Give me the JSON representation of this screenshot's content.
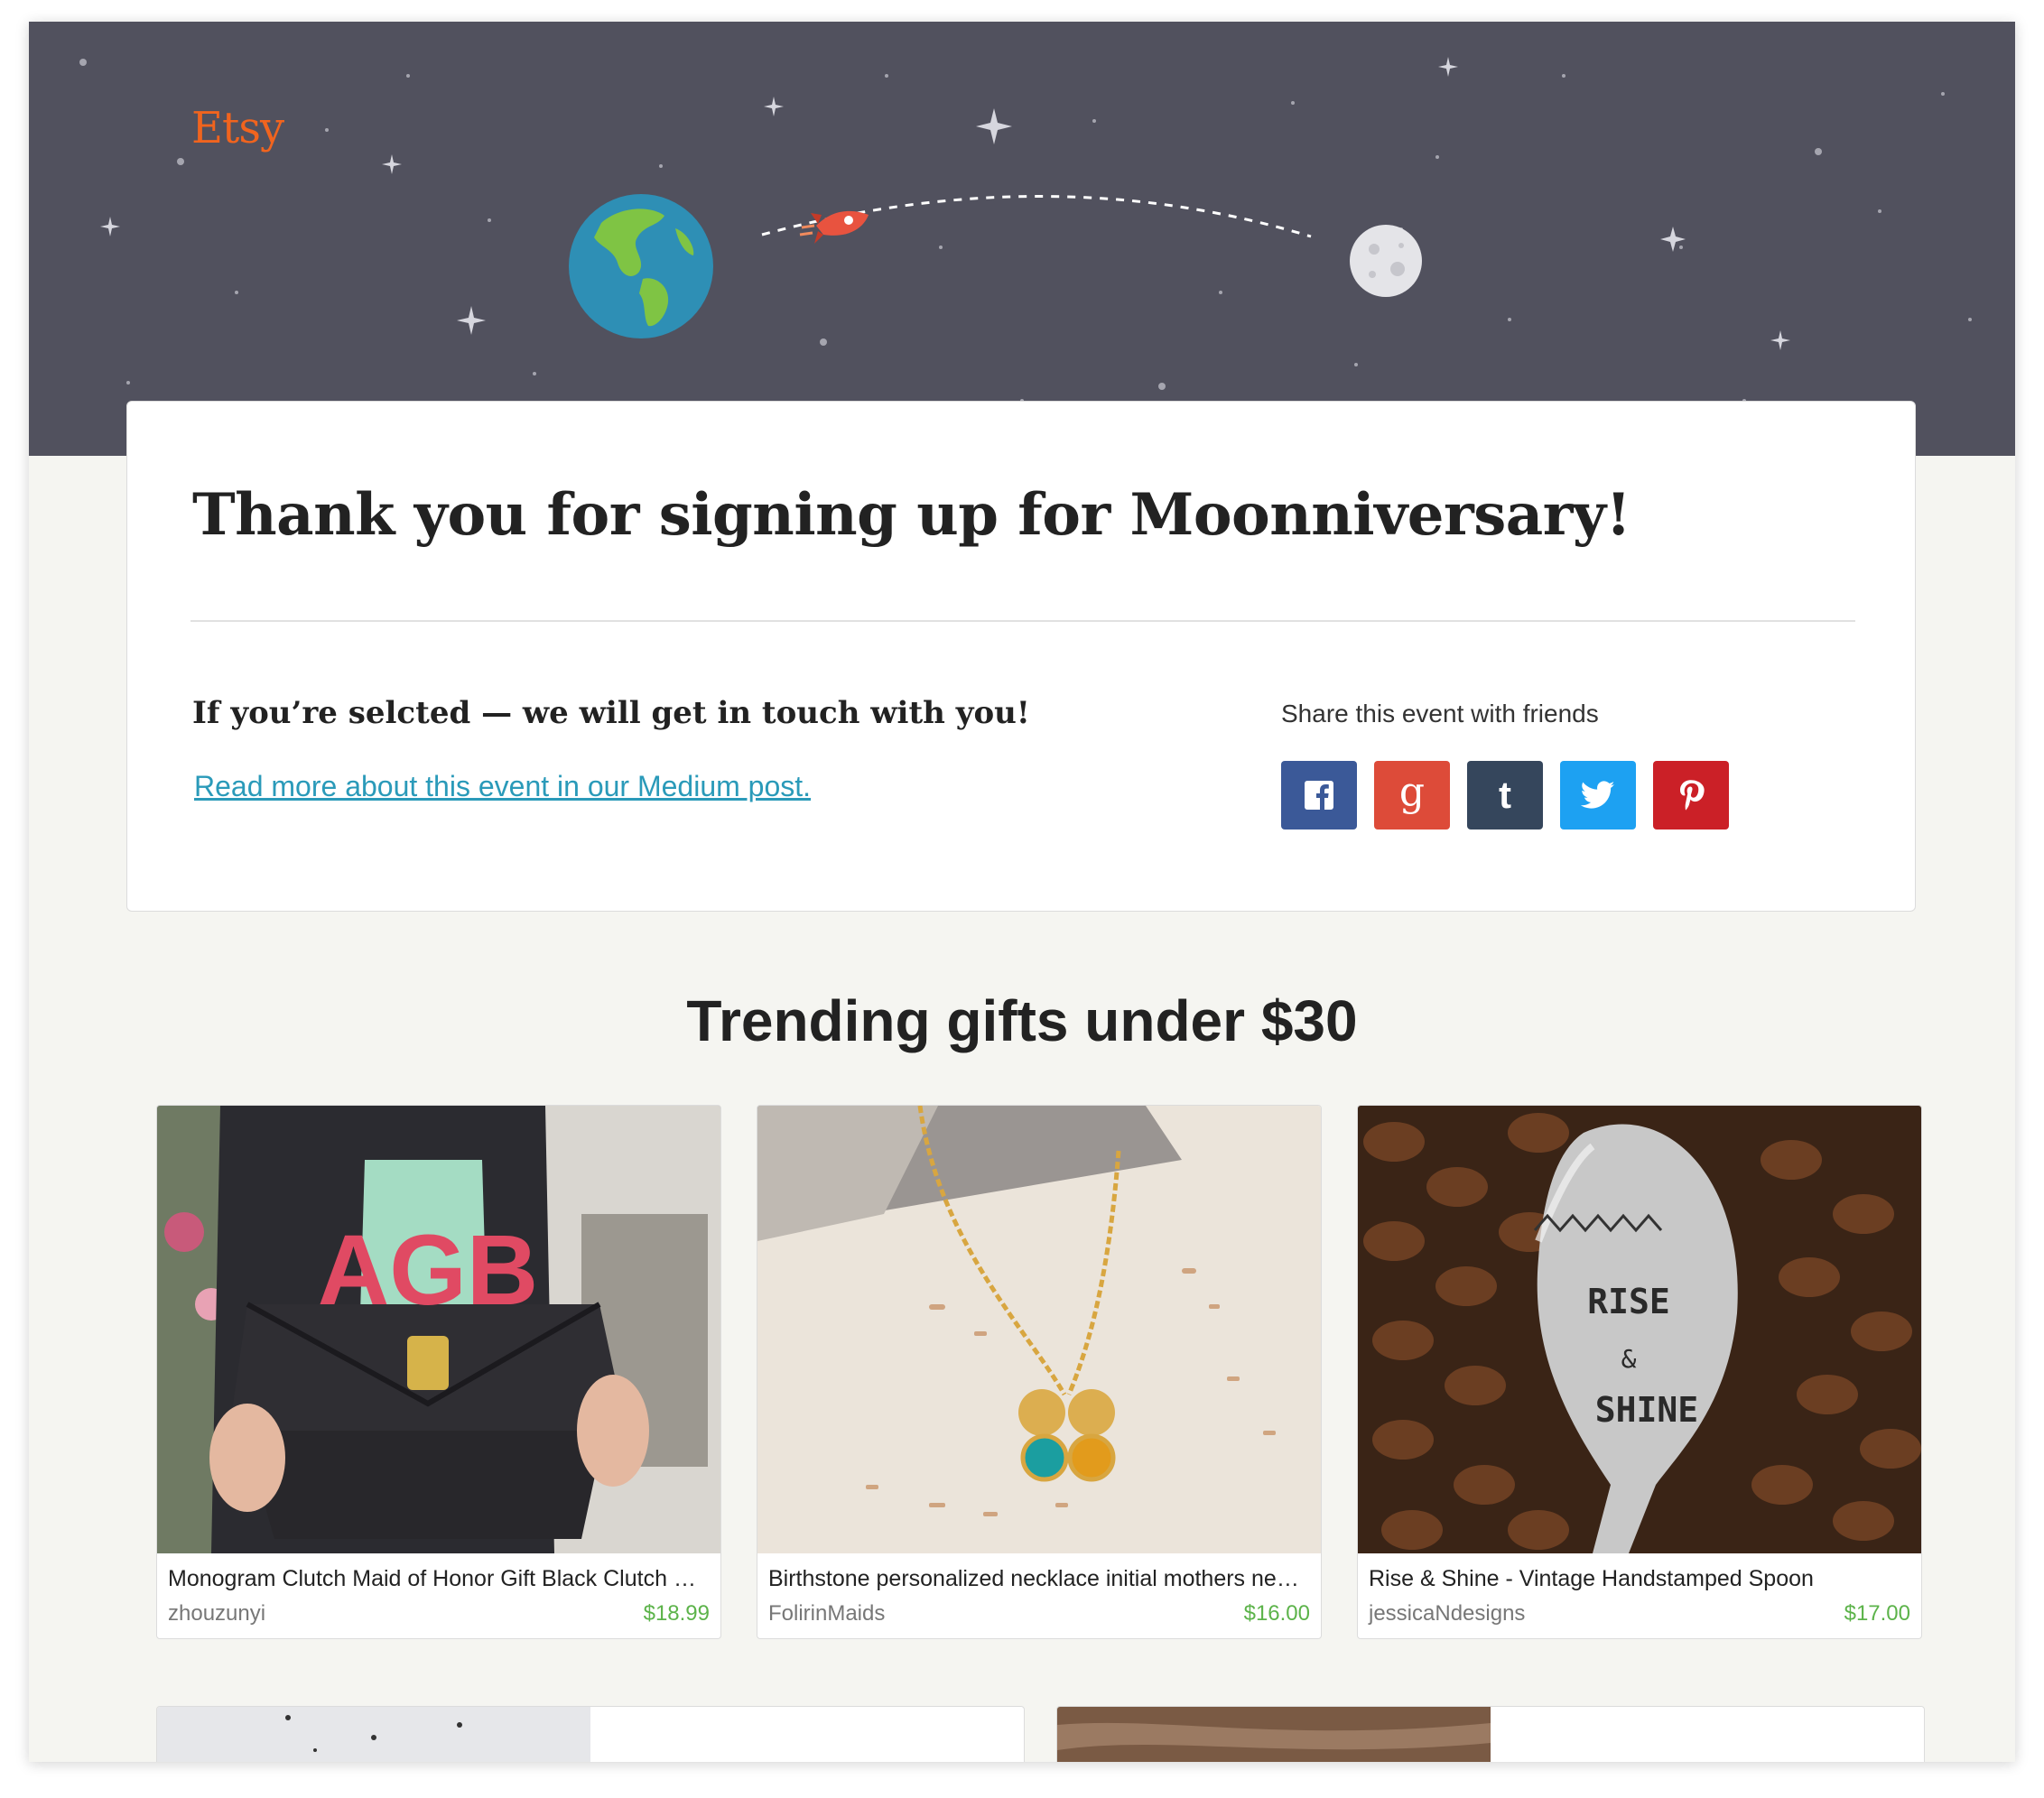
{
  "brand": {
    "logo": "Etsy",
    "accent": "#f1641e"
  },
  "hero": {
    "background": "#51515e",
    "illustrations": [
      "earth-icon",
      "rocket-icon",
      "moon-icon"
    ]
  },
  "confirmation": {
    "title": "Thank you for signing up for Moonniversary!",
    "selected_text": "If you’re selcted — we will get in touch with you!",
    "medium_link": "Read more about this event in our Medium post.",
    "share_label": "Share this event with friends",
    "share_buttons": [
      {
        "icon": "facebook-icon",
        "color": "#3b5998"
      },
      {
        "icon": "google-plus-icon",
        "color": "#dd4b39"
      },
      {
        "icon": "tumblr-icon",
        "color": "#35465c"
      },
      {
        "icon": "twitter-icon",
        "color": "#1da1f2"
      },
      {
        "icon": "pinterest-icon",
        "color": "#cb2027"
      }
    ]
  },
  "trending": {
    "title": "Trending gifts under $30",
    "price_color": "#5cb34a",
    "products": [
      {
        "title": "Monogram Clutch Maid of Honor Gift Black Clutch Purse Personalized",
        "shop": "zhouzunyi",
        "price": "$18.99",
        "image": "monogram-clutch-photo"
      },
      {
        "title": "Birthstone personalized necklace initial mothers necklace",
        "shop": "FolirinMaids",
        "price": "$16.00",
        "image": "birthstone-necklace-photo"
      },
      {
        "title": "Rise & Shine - Vintage Handstamped Spoon",
        "shop": "jessicaNdesigns",
        "price": "$17.00",
        "image": "handstamped-spoon-photo"
      }
    ]
  }
}
